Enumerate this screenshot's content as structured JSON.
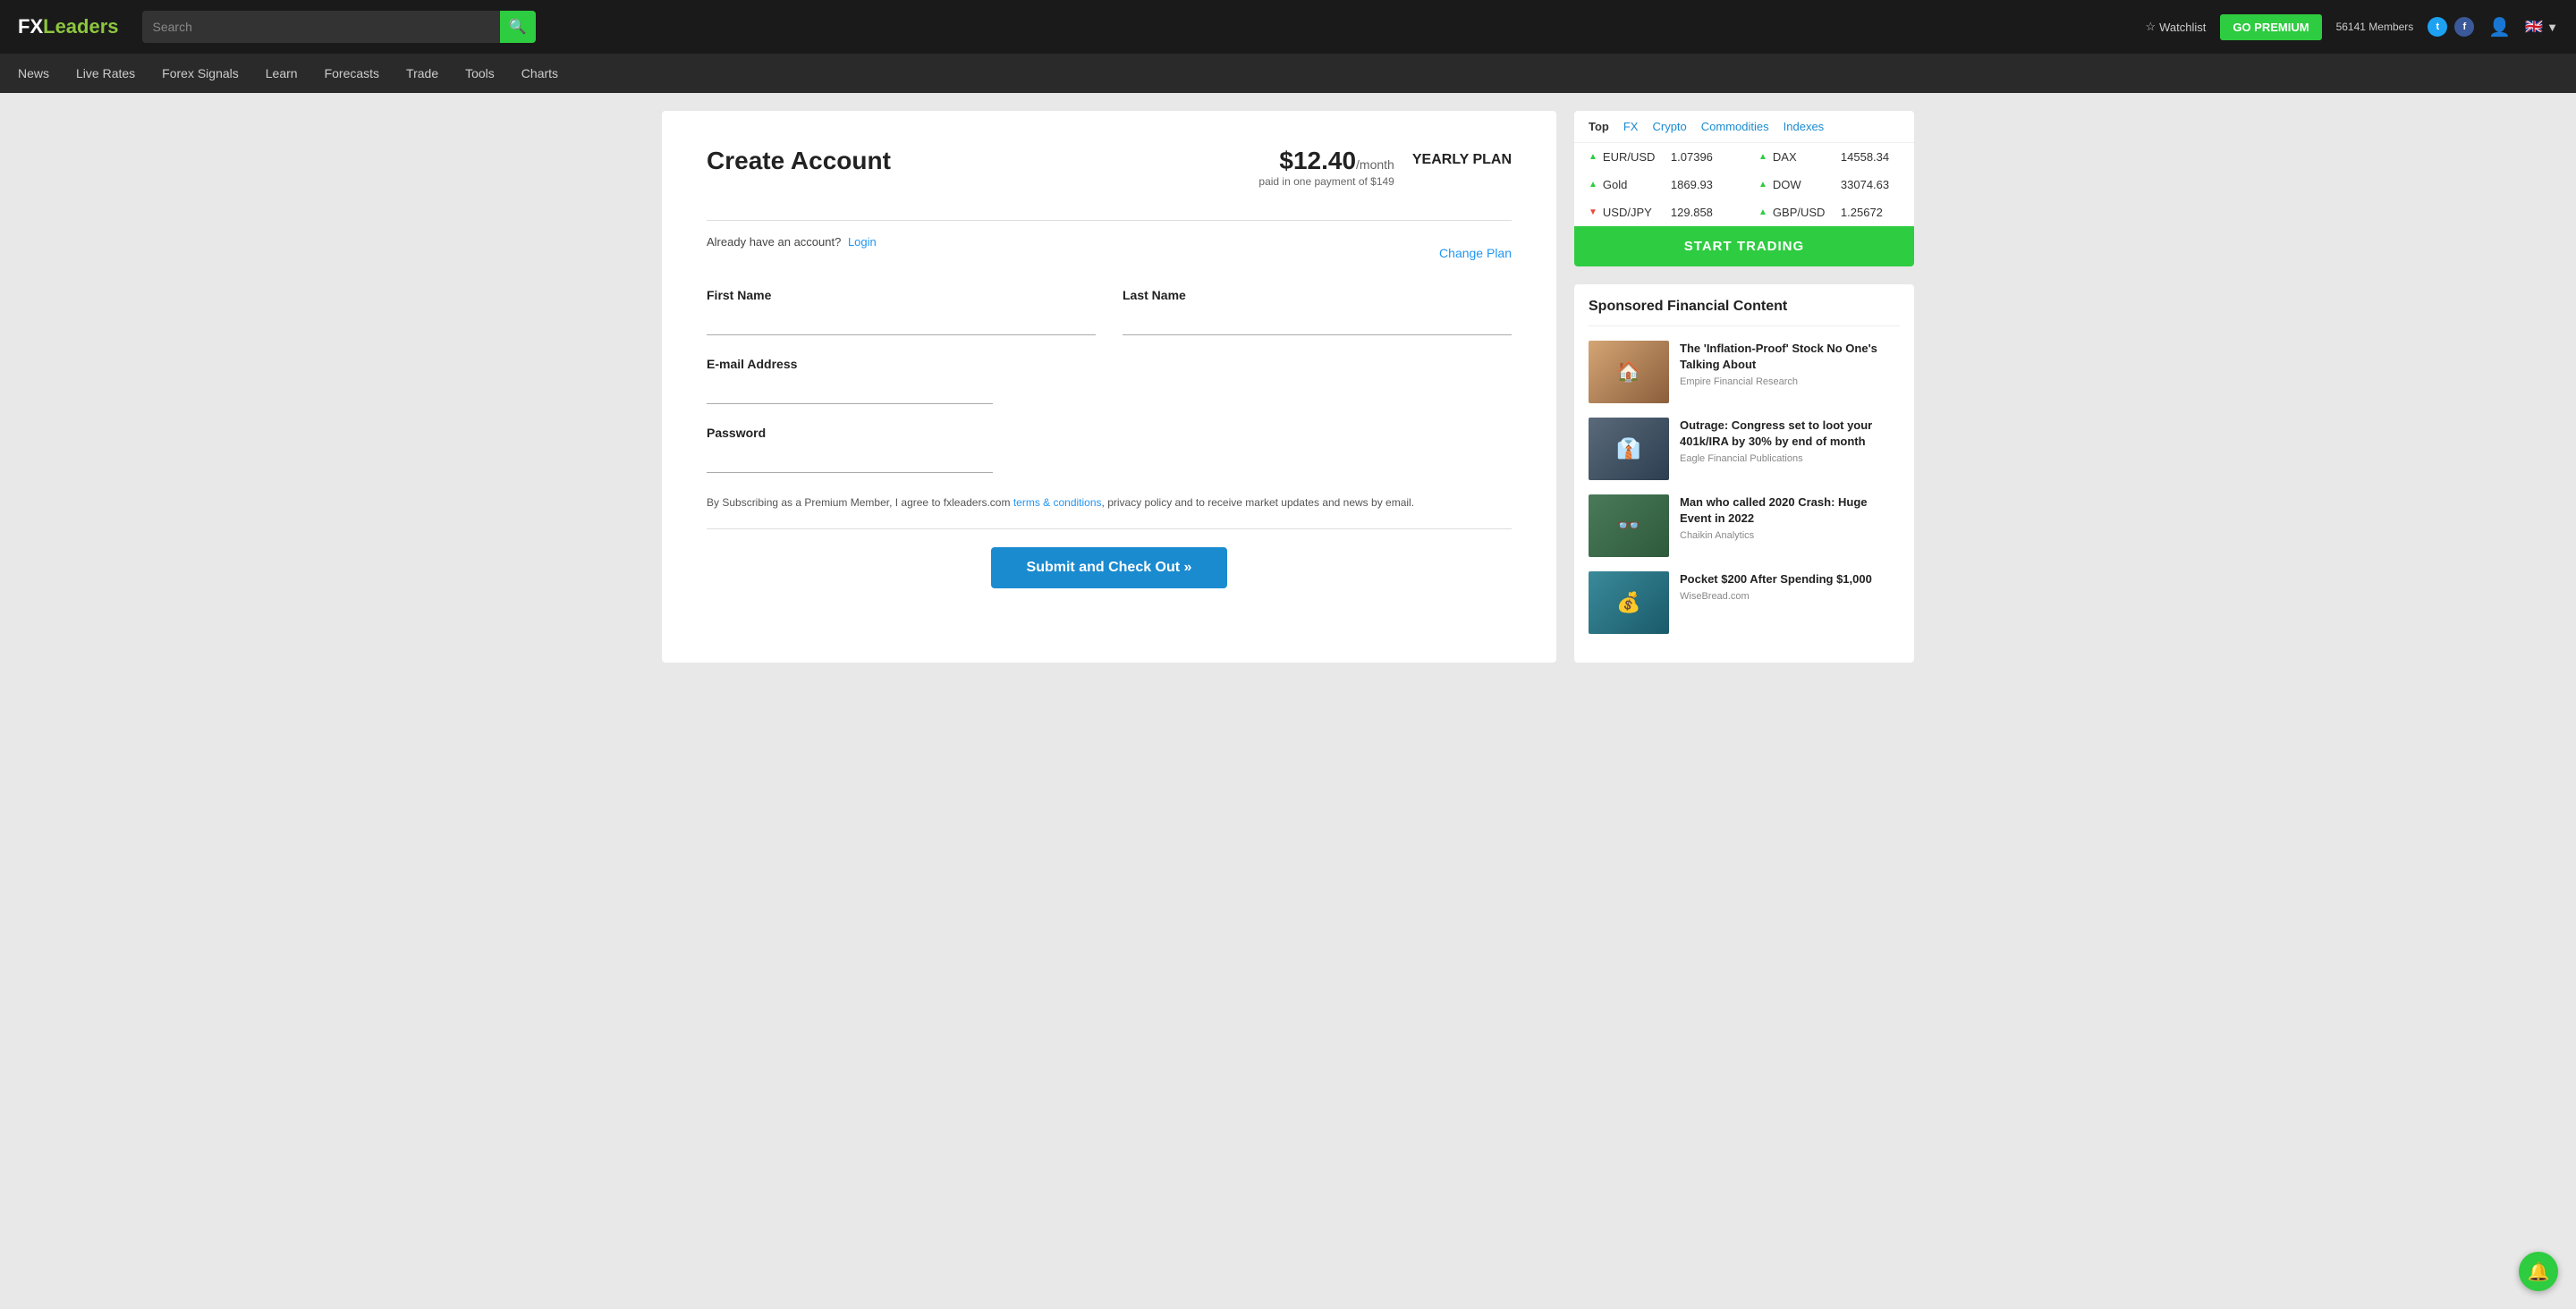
{
  "brand": {
    "fx": "FX",
    "leaders": "Leaders"
  },
  "header": {
    "search_placeholder": "Search",
    "watchlist_label": "Watchlist",
    "go_premium_label": "GO PREMIUM",
    "members_text": "56141 Members",
    "twitter_icon": "t",
    "facebook_icon": "f",
    "user_icon": "👤",
    "flag_icon": "🇬🇧",
    "dropdown_icon": "▼"
  },
  "nav": {
    "items": [
      {
        "label": "News",
        "id": "news"
      },
      {
        "label": "Live Rates",
        "id": "live-rates"
      },
      {
        "label": "Forex Signals",
        "id": "forex-signals"
      },
      {
        "label": "Learn",
        "id": "learn"
      },
      {
        "label": "Forecasts",
        "id": "forecasts"
      },
      {
        "label": "Trade",
        "id": "trade"
      },
      {
        "label": "Tools",
        "id": "tools"
      },
      {
        "label": "Charts",
        "id": "charts"
      }
    ]
  },
  "rates": {
    "tabs": [
      {
        "label": "Top",
        "active": true
      },
      {
        "label": "FX",
        "active": false
      },
      {
        "label": "Crypto",
        "active": false
      },
      {
        "label": "Commodities",
        "active": false
      },
      {
        "label": "Indexes",
        "active": false
      }
    ],
    "items": [
      {
        "name": "EUR/USD",
        "value": "1.07396",
        "direction": "up"
      },
      {
        "name": "DAX",
        "value": "14558.34",
        "direction": "up"
      },
      {
        "name": "Gold",
        "value": "1869.93",
        "direction": "up"
      },
      {
        "name": "DOW",
        "value": "33074.63",
        "direction": "up"
      },
      {
        "name": "USD/JPY",
        "value": "129.858",
        "direction": "down"
      },
      {
        "name": "GBP/USD",
        "value": "1.25672",
        "direction": "up"
      }
    ],
    "start_trading_label": "START TRADING"
  },
  "form": {
    "title": "Create Account",
    "price_amount": "$12.40",
    "price_per_month": "/month",
    "plan_label": "YEARLY PLAN",
    "price_note": "paid in one payment of $149",
    "login_prompt": "Already have an account?",
    "login_link": "Login",
    "change_plan_link": "Change Plan",
    "first_name_label": "First Name",
    "last_name_label": "Last Name",
    "email_label": "E-mail Address",
    "password_label": "Password",
    "terms_prefix": "By Subscribing as a Premium Member, I agree to fxleaders.com ",
    "terms_link": "terms & conditions",
    "terms_suffix": ", privacy policy and to receive market updates and news by email.",
    "submit_label": "Submit and Check Out »"
  },
  "sponsored": {
    "section_title": "Sponsored Financial Content",
    "items": [
      {
        "headline": "The 'Inflation-Proof' Stock No One's Talking About",
        "source": "Empire Financial Research",
        "thumb_class": "thumb-1",
        "thumb_icon": "🏠"
      },
      {
        "headline": "Outrage: Congress set to loot your 401k/IRA by 30% by end of month",
        "source": "Eagle Financial Publications",
        "thumb_class": "thumb-2",
        "thumb_icon": "👔"
      },
      {
        "headline": "Man who called 2020 Crash: Huge Event in 2022",
        "source": "Chaikin Analytics",
        "thumb_class": "thumb-3",
        "thumb_icon": "👓"
      },
      {
        "headline": "Pocket $200 After Spending $1,000",
        "source": "WiseBread.com",
        "thumb_class": "thumb-4",
        "thumb_icon": "💰"
      }
    ]
  },
  "notification": {
    "icon": "🔔"
  }
}
